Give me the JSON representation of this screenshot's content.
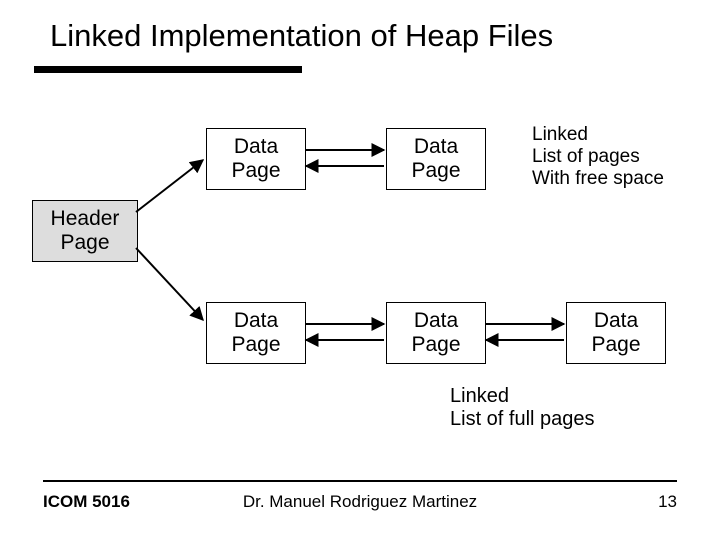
{
  "title": "Linked Implementation of Heap Files",
  "header_node": {
    "line1": "Header",
    "line2": "Page"
  },
  "free_row": {
    "nodes": [
      {
        "line1": "Data",
        "line2": "Page"
      },
      {
        "line1": "Data",
        "line2": "Page"
      }
    ],
    "annot": {
      "line1": "Linked",
      "line2": "List of pages",
      "line3": "With free space"
    }
  },
  "full_row": {
    "nodes": [
      {
        "line1": "Data",
        "line2": "Page"
      },
      {
        "line1": "Data",
        "line2": "Page"
      },
      {
        "line1": "Data",
        "line2": "Page"
      }
    ],
    "caption": {
      "line1": "Linked",
      "line2": "List of full pages"
    }
  },
  "footer": {
    "left": "ICOM 5016",
    "center": "Dr. Manuel Rodriguez Martinez",
    "right": "13"
  }
}
